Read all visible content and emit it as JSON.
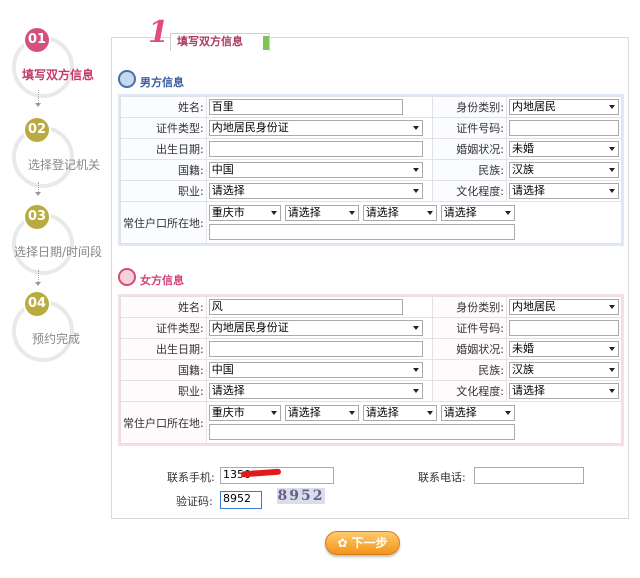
{
  "steps": [
    {
      "num": "01",
      "label": "填写双方信息"
    },
    {
      "num": "02",
      "label": "选择登记机关"
    },
    {
      "num": "03",
      "label": "选择日期/时间段"
    },
    {
      "num": "04",
      "label": "预约完成"
    }
  ],
  "page_title_number": "1",
  "page_title": "填写双方信息",
  "male": {
    "section_title": "男方信息",
    "labels": {
      "name": "姓名:",
      "id_category": "身份类别:",
      "id_type": "证件类型:",
      "id_number": "证件号码:",
      "birth_date": "出生日期:",
      "marital": "婚姻状况:",
      "nationality": "国籍:",
      "ethnicity": "民族:",
      "occupation": "职业:",
      "education": "文化程度:",
      "residence": "常住户口所在地:"
    },
    "values": {
      "name": "百里",
      "id_category": "内地居民",
      "id_type": "内地居民身份证",
      "id_number": "",
      "birth_date": "",
      "marital": "未婚",
      "nationality": "中国",
      "ethnicity": "汉族",
      "occupation": "请选择",
      "education": "请选择",
      "residence_city": "重庆市",
      "residence_2": "请选择",
      "residence_3": "请选择",
      "residence_4": "请选择",
      "residence_detail": ""
    }
  },
  "female": {
    "section_title": "女方信息",
    "labels": {
      "name": "姓名:",
      "id_category": "身份类别:",
      "id_type": "证件类型:",
      "id_number": "证件号码:",
      "birth_date": "出生日期:",
      "marital": "婚姻状况:",
      "nationality": "国籍:",
      "ethnicity": "民族:",
      "occupation": "职业:",
      "education": "文化程度:",
      "residence": "常住户口所在地:"
    },
    "values": {
      "name": "风",
      "id_category": "内地居民",
      "id_type": "内地居民身份证",
      "id_number": "",
      "birth_date": "",
      "marital": "未婚",
      "nationality": "中国",
      "ethnicity": "汉族",
      "occupation": "请选择",
      "education": "请选择",
      "residence_city": "重庆市",
      "residence_2": "请选择",
      "residence_3": "请选择",
      "residence_4": "请选择",
      "residence_detail": ""
    }
  },
  "contact": {
    "mobile_label": "联系手机:",
    "mobile_value": "1350",
    "phone_label": "联系电话:",
    "phone_value": "",
    "captcha_label": "验证码:",
    "captcha_input": "8952",
    "captcha_image_text": "8952"
  },
  "next_button": "下一步",
  "colors": {
    "active_step": "#d5507a",
    "pending_step": "#b9ab3f",
    "male_accent": "#3b5ca0",
    "female_accent": "#d2447a",
    "button_orange": "#f39418"
  }
}
